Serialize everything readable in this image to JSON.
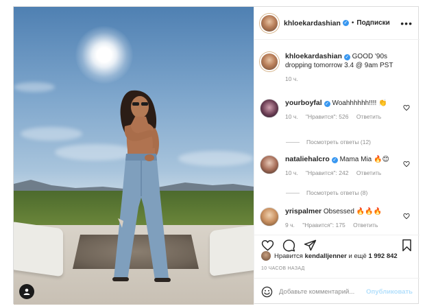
{
  "post": {
    "author": "khloekardashian",
    "follow_status": "Подписки",
    "caption": "GOOD '90s dropping tomorrow 3.4 @ 9am PST",
    "caption_time": "10 ч."
  },
  "comments": [
    {
      "user": "yourboyfal",
      "text": "Woahhhhhh!!!! 👏",
      "time": "10 ч.",
      "likes": "\"Нравится\": 526",
      "reply": "Ответить",
      "view_replies": "Посмотреть ответы (12)"
    },
    {
      "user": "nataliehalcro",
      "text": "Mama Mia 🔥😊",
      "time": "10 ч.",
      "likes": "\"Нравится\": 242",
      "reply": "Ответить",
      "view_replies": "Посмотреть ответы (8)"
    },
    {
      "user": "yrispalmer",
      "text": "Obsessed 🔥🔥🔥",
      "time": "9 ч.",
      "likes": "\"Нравится\": 175",
      "reply": "Ответить"
    }
  ],
  "likes_line": {
    "prefix": "Нравится",
    "user": "kendalljenner",
    "middle": "и ещё",
    "count": "1 992 842"
  },
  "timestamp": "10 ЧАСОВ НАЗАД",
  "comment_input": {
    "placeholder": "Добавьте комментарий...",
    "submit": "Опубликовать"
  },
  "colors": {
    "text": "#262626",
    "muted": "#8e8e8e",
    "verified": "#3897f0",
    "publish_disabled": "#b2dffc"
  },
  "icons": [
    "more-icon",
    "heart-icon",
    "comment-icon",
    "share-icon",
    "bookmark-icon",
    "smiley-icon",
    "verified-icon"
  ]
}
